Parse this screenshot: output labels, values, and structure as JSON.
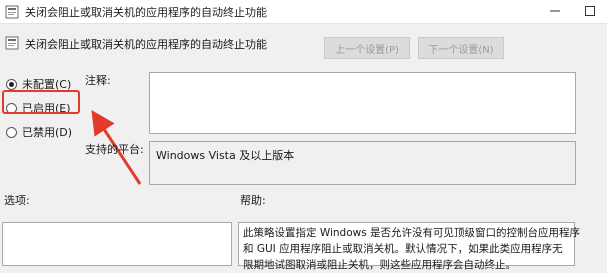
{
  "window": {
    "title": "关闭会阻止或取消关机的应用程序的自动终止功能"
  },
  "header": {
    "policy_title": "关闭会阻止或取消关机的应用程序的自动终止功能",
    "prev_label": "上一个设置(P)",
    "next_label": "下一个设置(N)"
  },
  "options": {
    "not_configured": "未配置(C)",
    "enabled": "已启用(E)",
    "disabled": "已禁用(D)",
    "selected": "not_configured"
  },
  "labels": {
    "comment": "注释:",
    "supported_on": "支持的平台:",
    "options": "选项:",
    "help": "帮助:"
  },
  "fields": {
    "comment_value": "",
    "supported_on_value": "Windows Vista 及以上版本"
  },
  "help_text": {
    "line1": "此策略设置指定 Windows 是否允许没有可见顶级窗口的控制台应用程序",
    "line2": "和 GUI 应用程序阻止或取消关机。默认情况下，如果此类应用程序无",
    "line3": "限期地试图取消或阻止关机，则这些应用程序会自动终止。"
  },
  "annotation": {
    "highlight_color": "#e23b2e"
  }
}
